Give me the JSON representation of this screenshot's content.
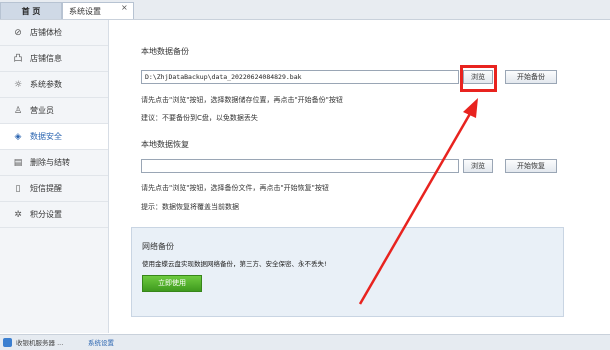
{
  "tabs": {
    "home": "首 页",
    "settings": "系统设置",
    "close": "×"
  },
  "sidebar": {
    "items": [
      {
        "icon": "shield-check-icon",
        "glyph": "⊘",
        "label": "店铺体检"
      },
      {
        "icon": "store-icon",
        "glyph": "凸",
        "label": "店铺信息"
      },
      {
        "icon": "gear-icon",
        "glyph": "☼",
        "label": "系统参数"
      },
      {
        "icon": "user-icon",
        "glyph": "♙",
        "label": "营业员"
      },
      {
        "icon": "security-shield-icon",
        "glyph": "◈",
        "label": "数据安全"
      },
      {
        "icon": "delete-icon",
        "glyph": "▤",
        "label": "删除与结转"
      },
      {
        "icon": "phone-icon",
        "glyph": "▯",
        "label": "短信提醒"
      },
      {
        "icon": "points-icon",
        "glyph": "✲",
        "label": "积分设置"
      }
    ],
    "active_index": 4
  },
  "backup": {
    "title": "本地数据备份",
    "path": "D:\\ZhjDataBackup\\data_20220624084829.bak",
    "browse": "浏览",
    "start": "开始备份",
    "hint1": "请先点击\"浏览\"按钮，选择数据储存位置，再点击\"开始备份\"按钮",
    "hint2": "建议：不要备份到C盘，以免数据丢失"
  },
  "restore": {
    "title": "本地数据恢复",
    "path": "",
    "browse": "浏览",
    "start": "开始恢复",
    "hint1": "请先点击\"浏览\"按钮，选择备份文件，再点击\"开始恢复\"按钮",
    "hint2": "提示：数据恢复将覆盖当前数据"
  },
  "network": {
    "title": "网络备份",
    "desc": "使用金蝶云盘实现数据网络备份，第三方、安全保密、永不丢失!",
    "button": "立即使用"
  },
  "statusbar": {
    "text": "收银机服务器 ...",
    "link": "系统设置"
  },
  "colors": {
    "highlight": "#e8231f",
    "accent": "#2a64b0",
    "green": "#4caf2a"
  }
}
